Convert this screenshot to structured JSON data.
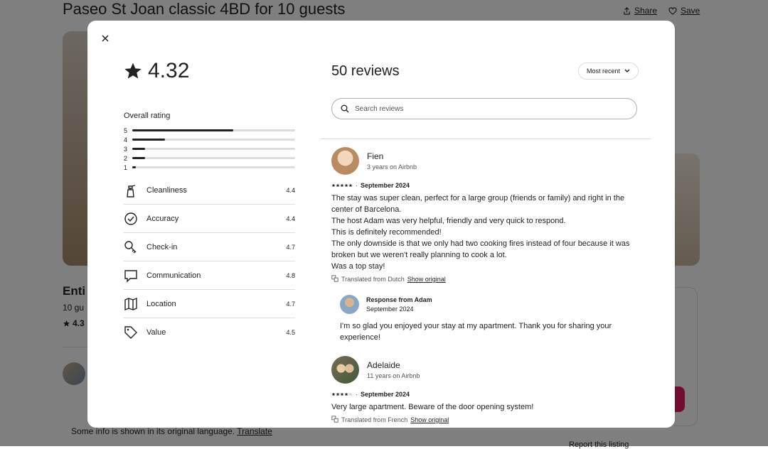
{
  "background": {
    "listing_title": "Paseo St Joan classic 4BD for 10 guests",
    "share_label": "Share",
    "save_label": "Save",
    "entire_partial": "Enti",
    "guests_partial": "10 gu",
    "rating_partial": "4.3",
    "info_text": "Some info is shown in its original language.",
    "translate_label": "Translate",
    "report_label": "Report this listing"
  },
  "modal": {
    "overall_rating": "4.32",
    "overall_label": "Overall rating",
    "distribution": [
      {
        "stars": "5",
        "fraction": 0.62
      },
      {
        "stars": "4",
        "fraction": 0.2
      },
      {
        "stars": "3",
        "fraction": 0.08
      },
      {
        "stars": "2",
        "fraction": 0.08
      },
      {
        "stars": "1",
        "fraction": 0.02
      }
    ],
    "categories": [
      {
        "label": "Cleanliness",
        "value": "4.4",
        "icon": "spray-bottle-icon"
      },
      {
        "label": "Accuracy",
        "value": "4.4",
        "icon": "check-circle-icon"
      },
      {
        "label": "Check-in",
        "value": "4.7",
        "icon": "key-icon"
      },
      {
        "label": "Communication",
        "value": "4.8",
        "icon": "chat-bubble-icon"
      },
      {
        "label": "Location",
        "value": "4.7",
        "icon": "map-icon"
      },
      {
        "label": "Value",
        "value": "4.5",
        "icon": "tag-icon"
      }
    ],
    "reviews_title": "50 reviews",
    "sort_label": "Most recent",
    "search_placeholder": "Search reviews",
    "reviews": [
      {
        "name": "Fien",
        "meta": "3 years on Airbnb",
        "stars": 5,
        "date": "September 2024",
        "text": [
          "The stay was super clean, perfect for a large group (friends or family) and right in the center of Barcelona.",
          "The host Adam was very helpful, friendly and very quick to respond.",
          "This is definitely recommended!",
          "The only downside is that we only had two cooking fires instead of four because it was broken but we weren't really planning to cook a lot.",
          "Was a top stay!"
        ],
        "translated_from": "Translated from Dutch",
        "show_original": "Show original",
        "response": {
          "title": "Response from Adam",
          "date": "September 2024",
          "text": "I'm so glad you enjoyed your stay at my apartment. Thank you for sharing your experience!"
        }
      },
      {
        "name": "Adelaide",
        "meta": "11 years on Airbnb",
        "stars": 4,
        "date": "September 2024",
        "text": [
          "Very large apartment. Beware of the door opening system!"
        ],
        "translated_from": "Translated from French",
        "show_original": "Show original"
      }
    ],
    "colors": {
      "text": "#222222",
      "muted": "#555555",
      "accent": "#e31c5f"
    }
  }
}
